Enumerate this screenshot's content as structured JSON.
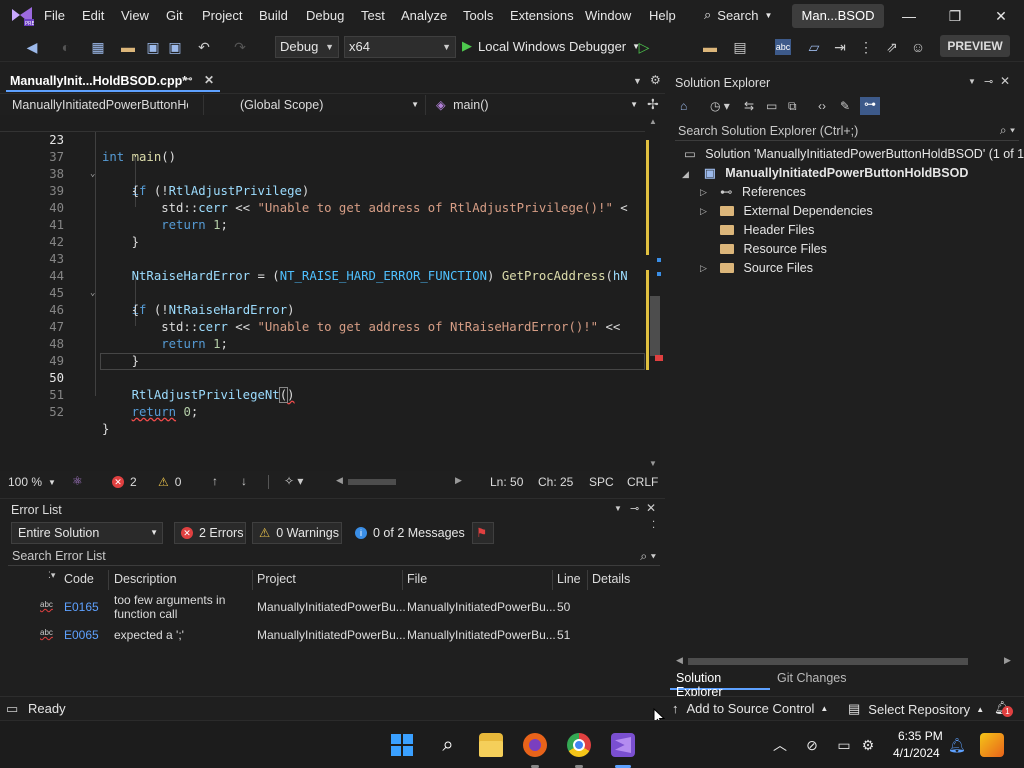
{
  "menu": {
    "items": [
      "File",
      "Edit",
      "View",
      "Git",
      "Project",
      "Build",
      "Debug",
      "Test",
      "Analyze",
      "Tools",
      "Extensions",
      "Window",
      "Help"
    ],
    "search_label": "Search",
    "solution_short": "Man...BSOD"
  },
  "toolbar": {
    "config": "Debug",
    "platform": "x64",
    "debugger_label": "Local Windows Debugger",
    "preview_label": "PREVIEW"
  },
  "editor": {
    "tab_title": "ManuallyInit...HoldBSOD.cpp*",
    "nav_file": "ManuallyInitiatedPowerButtonHo",
    "nav_scope": "(Global Scope)",
    "nav_function": "main()",
    "sticky_line": {
      "num": "23",
      "text": "int main()"
    },
    "lines": [
      {
        "num": "37",
        "text": "    if (!RtlAdjustPrivilege)"
      },
      {
        "num": "38",
        "text": "    {"
      },
      {
        "num": "39",
        "text": "        std::cerr << \"Unable to get address of RtlAdjustPrivilege()!\" <"
      },
      {
        "num": "40",
        "text": "        return 1;"
      },
      {
        "num": "41",
        "text": "    }"
      },
      {
        "num": "42",
        "text": ""
      },
      {
        "num": "43",
        "text": "    NtRaiseHardError = (NT_RAISE_HARD_ERROR_FUNCTION) GetProcAddress(hN"
      },
      {
        "num": "44",
        "text": "    if (!NtRaiseHardError)"
      },
      {
        "num": "45",
        "text": "    {"
      },
      {
        "num": "46",
        "text": "        std::cerr << \"Unable to get address of NtRaiseHardError()!\" <<"
      },
      {
        "num": "47",
        "text": "        return 1;"
      },
      {
        "num": "48",
        "text": "    }"
      },
      {
        "num": "49",
        "text": ""
      },
      {
        "num": "50",
        "text": "    RtlAdjustPrivilegeNt()"
      },
      {
        "num": "51",
        "text": "    return 0;"
      },
      {
        "num": "52",
        "text": "}"
      }
    ],
    "zoom": "100 %",
    "errors_count": "2",
    "warnings_count": "0",
    "ln": "Ln: 50",
    "ch": "Ch: 25",
    "spc": "SPC",
    "crlf": "CRLF"
  },
  "error_list": {
    "title": "Error List",
    "scope": "Entire Solution",
    "errors_btn": "2 Errors",
    "warnings_btn": "0 Warnings",
    "messages_btn": "0 of 2 Messages",
    "search_placeholder": "Search Error List",
    "columns": [
      "Code",
      "Description",
      "Project",
      "File",
      "Line",
      "Details"
    ],
    "rows": [
      {
        "code": "E0165",
        "desc1": "too few arguments in",
        "desc2": "function call",
        "project": "ManuallyInitiatedPowerBu...",
        "file": "ManuallyInitiatedPowerBu...",
        "line": "50"
      },
      {
        "code": "E0065",
        "desc1": "expected a ';'",
        "desc2": "",
        "project": "ManuallyInitiatedPowerBu...",
        "file": "ManuallyInitiatedPowerBu...",
        "line": "51"
      }
    ]
  },
  "solution_explorer": {
    "title": "Solution Explorer",
    "search_placeholder": "Search Solution Explorer (Ctrl+;)",
    "solution_line": "Solution 'ManuallyInitiatedPowerButtonHoldBSOD' (1 of 1",
    "project": "ManuallyInitiatedPowerButtonHoldBSOD",
    "items": [
      "References",
      "External Dependencies",
      "Header Files",
      "Resource Files",
      "Source Files"
    ],
    "tabs": [
      "Solution Explorer",
      "Git Changes"
    ]
  },
  "statusbar": {
    "ready": "Ready",
    "add_source": "Add to Source Control",
    "select_repo": "Select Repository",
    "notif_count": "1"
  },
  "taskbar": {
    "time": "6:35 PM",
    "date": "4/1/2024"
  }
}
